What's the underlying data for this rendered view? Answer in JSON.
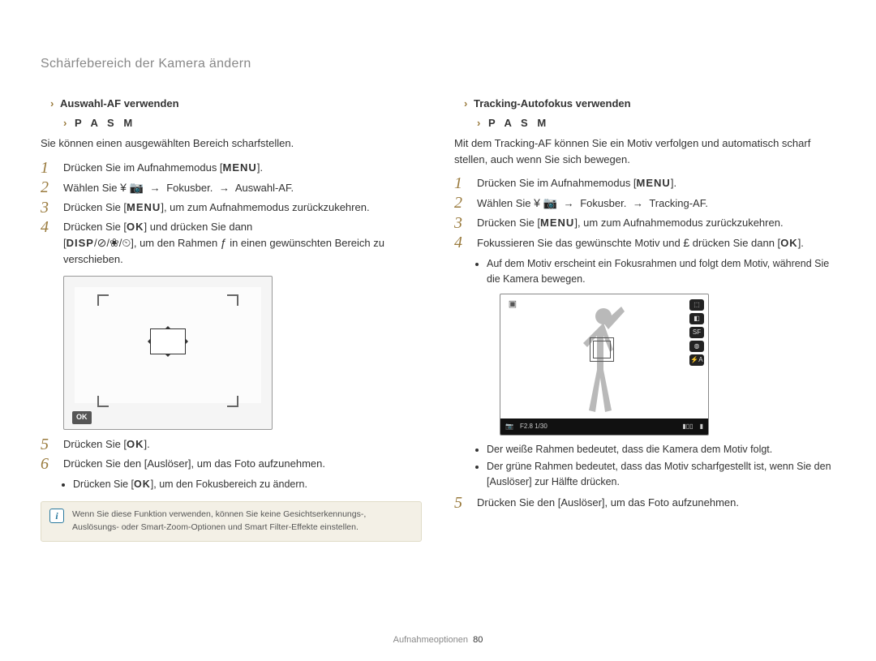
{
  "header": "Schärfebereich der Kamera ändern",
  "left": {
    "section_title": "Auswahl-AF verwenden",
    "modes": "P A S M",
    "intro": "Sie können einen ausgewählten Bereich scharfstellen.",
    "steps": {
      "s1": "Drücken Sie im Aufnahmemodus [MENU].",
      "s2_a": "Wählen Sie",
      "s2_b": "Fokusber.",
      "s2_c": "Auswahl-AF",
      "s3": "Drücken Sie [MENU], um zum Aufnahmemodus zurückzukehren.",
      "s4_a": "Drücken Sie [OK] und drücken Sie dann",
      "s4_b": "[DISP/",
      "s4_c": "/",
      "s4_d": "/",
      "s4_e": "], um den Rahmen in einen gewünschten Bereich zu verschieben.",
      "s5": "Drücken Sie [OK].",
      "s6": "Drücken Sie den [Auslöser], um das Foto aufzunehmen."
    },
    "bullet": "Drücken Sie [OK], um den Fokusbereich zu ändern.",
    "note": "Wenn Sie diese Funktion verwenden, können Sie keine Gesichtserkennungs-, Auslösungs- oder Smart-Zoom-Optionen und Smart Filter-Effekte einstellen."
  },
  "right": {
    "section_title": "Tracking-Autofokus verwenden",
    "modes": "P A S M",
    "intro": "Mit dem Tracking-AF können Sie ein Motiv verfolgen und automatisch scharf stellen, auch wenn Sie sich bewegen.",
    "steps": {
      "s1": "Drücken Sie im Aufnahmemodus [MENU].",
      "s2_a": "Wählen Sie",
      "s2_b": "Fokusber.",
      "s2_c": "Tracking-AF",
      "s3": "Drücken Sie [MENU], um zum Aufnahmemodus zurückzukehren.",
      "s4_a": "Fokussieren Sie das gewünschte Motiv und drücken Sie dann [OK].",
      "s5": "Drücken Sie den [Auslöser], um das Foto aufzunehmen."
    },
    "sub_s4_1": "Auf dem Motiv erscheint ein Fokusrahmen und folgt dem Motiv, während Sie die Kamera bewegen.",
    "bullets": {
      "b1": "Der weiße Rahmen bedeutet, dass die Kamera dem Motiv folgt.",
      "b2_a": "Der grüne Rahmen bedeutet, dass das Motiv scharfgestellt ist, wenn Sie den [",
      "b2_b": "Auslöser",
      "b2_c": "] zur Hälfte drücken."
    },
    "illus": {
      "exposure": "F2.8  1/30"
    }
  },
  "footer": {
    "label": "Aufnahmeoptionen",
    "page": "80"
  },
  "icons": {
    "arrow_marker": "›",
    "yen": "¥",
    "camera": "📷",
    "right_arrow": "→",
    "timer": "⏲",
    "flower": "❀",
    "f": "ƒ",
    "disp_glyph": "⊘",
    "pound": "£"
  }
}
